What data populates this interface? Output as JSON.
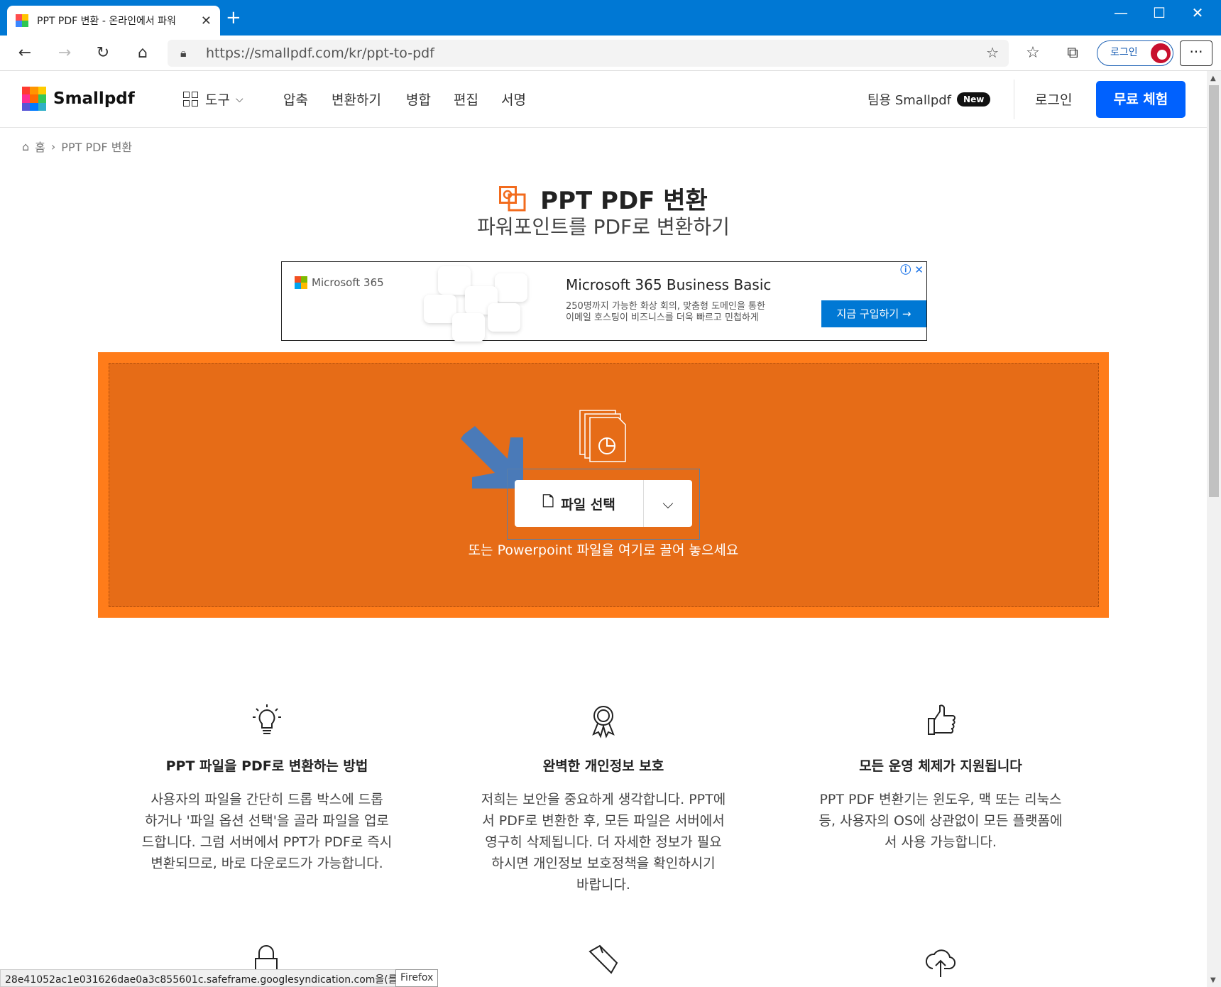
{
  "browser": {
    "tab_title": "PPT PDF 변환 - 온라인에서 파워",
    "url": "https://smallpdf.com/kr/ppt-to-pdf",
    "profile_label": "로그인"
  },
  "header": {
    "logo": "Smallpdf",
    "nav": {
      "tools": "도구",
      "compress": "압축",
      "convert": "변환하기",
      "merge": "병합",
      "edit": "편집",
      "sign": "서명"
    },
    "team": "팀용 Smallpdf",
    "team_badge": "New",
    "login": "로그인",
    "trial": "무료 체험"
  },
  "breadcrumb": {
    "home": "홈",
    "sep": "›",
    "current": "PPT PDF 변환"
  },
  "hero": {
    "title": "PPT PDF 변환",
    "subtitle": "파워포인트를 PDF로 변환하기"
  },
  "ad": {
    "brand": "Microsoft 365",
    "title": "Microsoft 365 Business Basic",
    "desc_1": "250명까지 가능한 화상 회의, 맞춤형 도메인을 통한",
    "desc_2": "이메일 호스팅이 비즈니스를 더욱 빠르고 민첩하게",
    "cta": "지금 구입하기 →"
  },
  "dropzone": {
    "button": "파일 선택",
    "hint": "또는 Powerpoint 파일을 여기로 끌어 놓으세요"
  },
  "features": [
    {
      "icon": "lightbulb-icon",
      "title": "PPT 파일을 PDF로 변환하는 방법",
      "lines": [
        "사용자의 파일을 간단히 드롭 박스에 드롭",
        "하거나 '파일 옵션 선택'을 골라 파일을 업로",
        "드합니다. 그럼 서버에서 PPT가 PDF로 즉시",
        "변환되므로, 바로 다운로드가 가능합니다."
      ]
    },
    {
      "icon": "award-icon",
      "title": "완벽한 개인정보 보호",
      "lines": [
        "저희는 보안을 중요하게 생각합니다. PPT에",
        "서 PDF로 변환한 후, 모든 파일은 서버에서",
        "영구히 삭제됩니다. 더 자세한 정보가 필요",
        "하시면 개인정보 보호정책을 확인하시기",
        "바랍니다."
      ]
    },
    {
      "icon": "thumbs-up-icon",
      "title": "모든 운영 체제가 지원됩니다",
      "lines": [
        "PPT PDF 변환기는 윈도우, 맥 또는 리눅스",
        "등, 사용자의 OS에 상관없이 모든 플랫폼에",
        "서 사용 가능합니다."
      ]
    }
  ],
  "status": {
    "text": "28e41052ac1e031626dae0a3c855601c.safeframe.googlesyndication.com을(를) 기...",
    "tooltip": "Firefox"
  },
  "colors": {
    "browser_blue": "#0078d4",
    "orange": "#ff7c1a",
    "orange_dark": "#e66c17",
    "primary": "#0061fe"
  }
}
